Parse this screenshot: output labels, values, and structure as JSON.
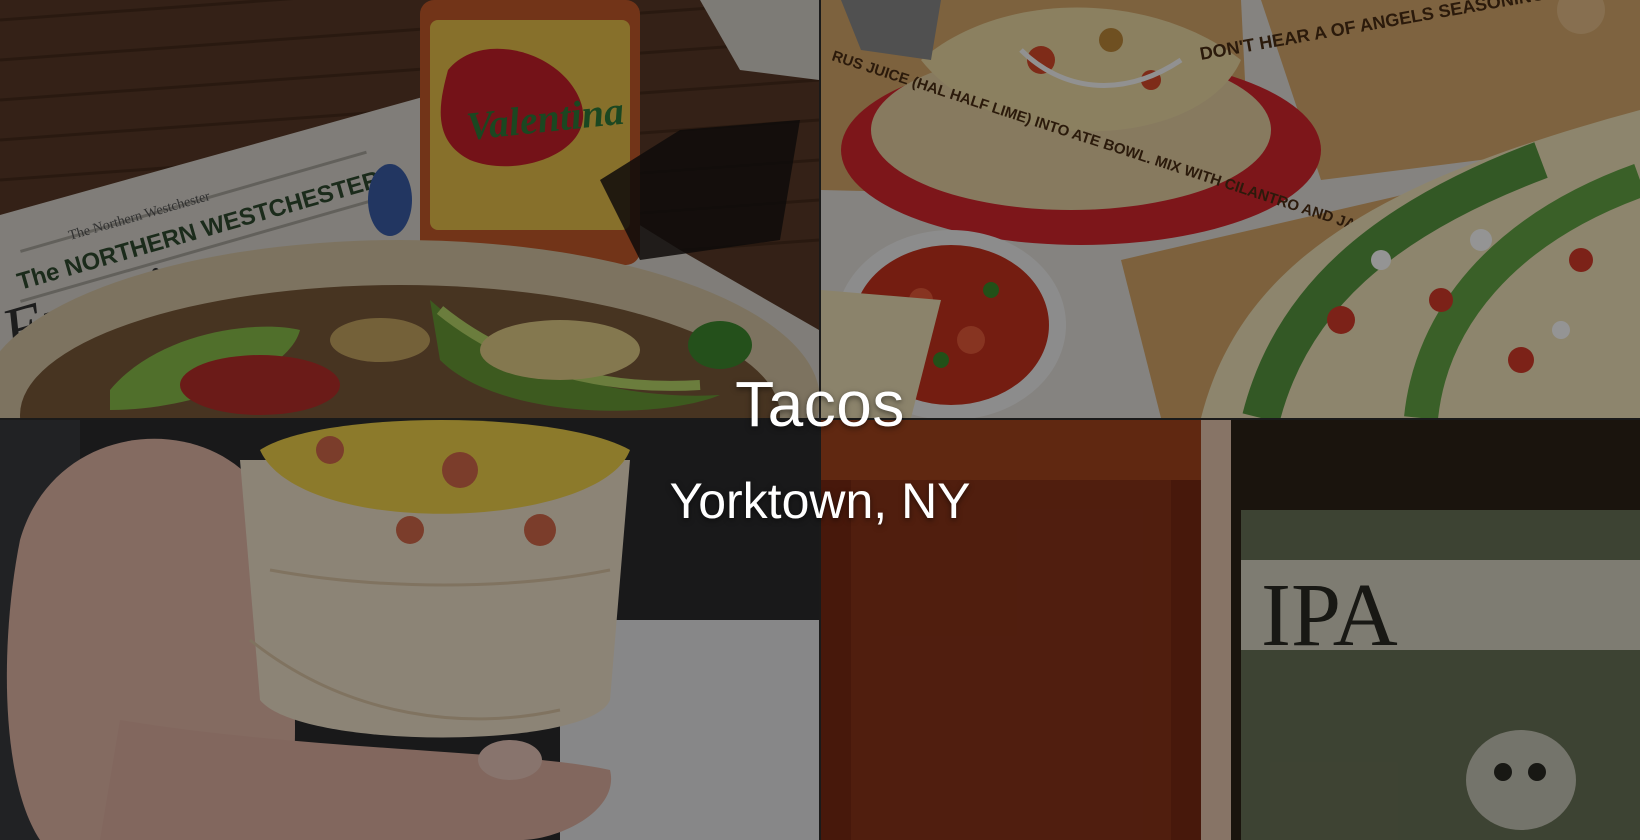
{
  "hero": {
    "title": "Tacos",
    "subtitle": "Yorktown, NY"
  },
  "photos": {
    "newspaper_brand": "Examiner",
    "newspaper_header": "The NORTHERN WESTCHESTER",
    "newspaper_kicker": "The Northern Westchester",
    "hot_sauce_brand": "Valentina",
    "bag_text": "RUS JUICE (HAL HALF LIME) INTO ATE BOWL. MIX WITH CILANTRO AND JALAPENOS.",
    "bag_text_2": "DON'T HEAR A OF ANGELS SEASONING",
    "beer_label": "IPA"
  },
  "colors": {
    "overlay": "rgba(0,0,0,0.42)",
    "caption_text": "#ffffff"
  }
}
